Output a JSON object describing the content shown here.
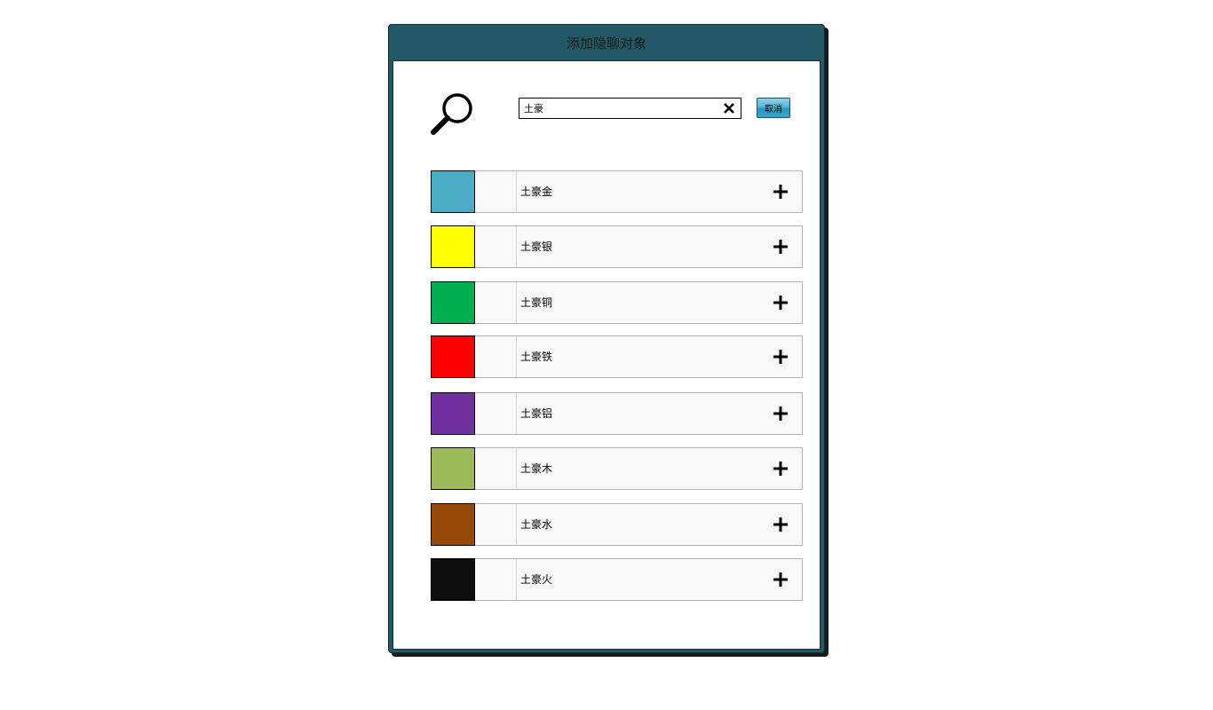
{
  "dialog": {
    "title": "添加隐聊对象"
  },
  "search": {
    "value": "土豪",
    "placeholder": "",
    "cancel_label": "取消"
  },
  "icons": {
    "search": "magnifier-icon",
    "clear": "close-x-icon",
    "add": "plus-icon"
  },
  "results": [
    {
      "name": "土豪金",
      "color": "#4bacc6"
    },
    {
      "name": "土豪银",
      "color": "#ffff00"
    },
    {
      "name": "土豪铜",
      "color": "#00b050"
    },
    {
      "name": "土豪铁",
      "color": "#ff0000"
    },
    {
      "name": "土豪铝",
      "color": "#7030a0"
    },
    {
      "name": "土豪木",
      "color": "#9bbb59"
    },
    {
      "name": "土豪水",
      "color": "#984807"
    },
    {
      "name": "土豪火",
      "color": "#0d0d0d"
    }
  ],
  "colors": {
    "frame": "#225866",
    "row_background": "#f9f9f9"
  }
}
